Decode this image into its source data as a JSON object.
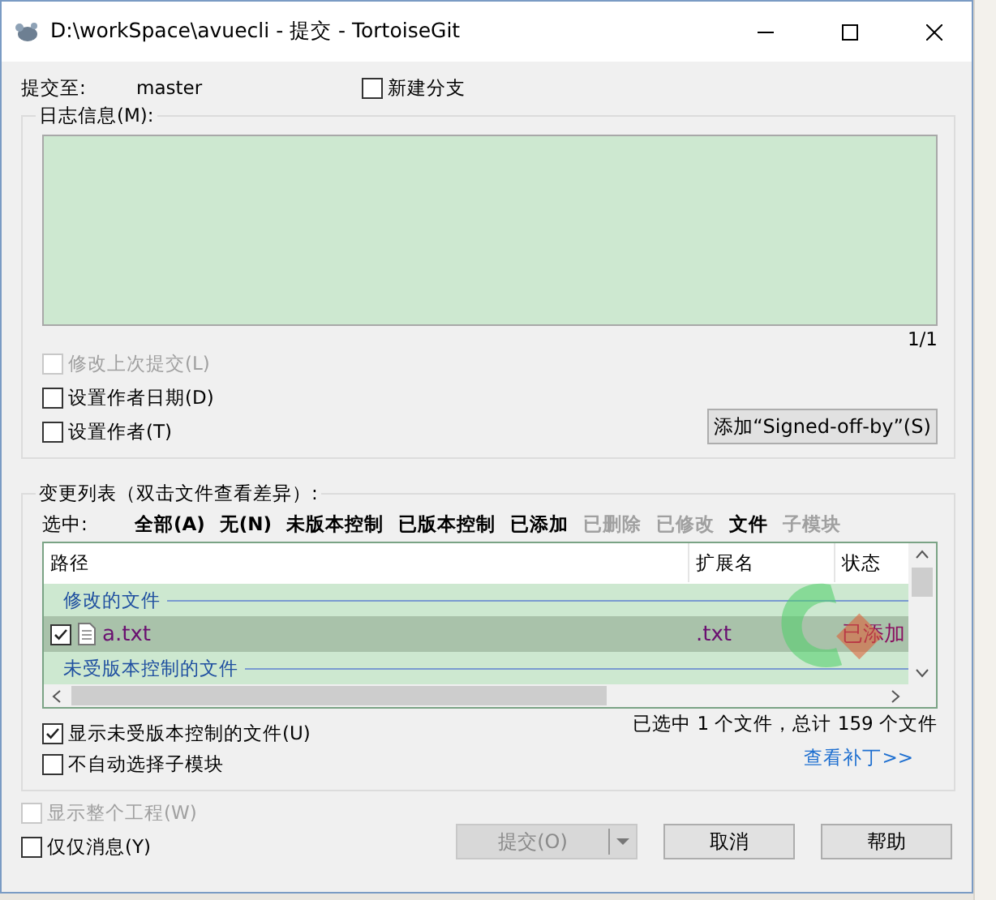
{
  "window": {
    "title": "D:\\workSpace\\avuecli - 提交 - TortoiseGit"
  },
  "commit_to": {
    "label": "提交至:",
    "value": "master"
  },
  "new_branch": {
    "label": "新建分支",
    "checked": false
  },
  "log": {
    "label": "日志信息(M):",
    "counter": "1/1"
  },
  "log_options": [
    {
      "label": "修改上次提交(L)",
      "checked": false,
      "disabled": true
    },
    {
      "label": "设置作者日期(D)",
      "checked": false,
      "disabled": false
    },
    {
      "label": "设置作者(T)",
      "checked": false,
      "disabled": false
    }
  ],
  "signoff_button": "添加“Signed-off-by”(S)",
  "changes": {
    "label": "变更列表（双击文件查看差异）:",
    "select_label": "选中:",
    "filters": [
      {
        "label": "全部(A)",
        "disabled": false
      },
      {
        "label": "无(N)",
        "disabled": false
      },
      {
        "label": "未版本控制",
        "disabled": false
      },
      {
        "label": "已版本控制",
        "disabled": false
      },
      {
        "label": "已添加",
        "disabled": false
      },
      {
        "label": "已删除",
        "disabled": true
      },
      {
        "label": "已修改",
        "disabled": true
      },
      {
        "label": "文件",
        "disabled": false
      },
      {
        "label": "子模块",
        "disabled": true
      }
    ]
  },
  "table": {
    "columns": [
      "路径",
      "扩展名",
      "状态"
    ],
    "rows": [
      {
        "kind": "group",
        "label": "修改的文件"
      },
      {
        "kind": "file",
        "path": "a.txt",
        "ext": ".txt",
        "status": "已添加",
        "checked": true,
        "selected": true
      },
      {
        "kind": "group",
        "label": "未受版本控制的文件"
      }
    ]
  },
  "list_options": [
    {
      "label": "显示未受版本控制的文件(U)",
      "checked": true,
      "disabled": false
    },
    {
      "label": "不自动选择子模块",
      "checked": false,
      "disabled": false
    }
  ],
  "summary": "已选中 1 个文件，总计 159 个文件",
  "patch_link": "查看补丁>>",
  "bottom_options": [
    {
      "label": "显示整个工程(W)",
      "checked": false,
      "disabled": true
    },
    {
      "label": "仅仅消息(Y)",
      "checked": false,
      "disabled": false
    }
  ],
  "buttons": [
    {
      "kind": "split",
      "label": "提交(O)",
      "disabled": true
    },
    {
      "kind": "plain",
      "label": "取消",
      "disabled": false
    },
    {
      "kind": "plain",
      "label": "帮助",
      "disabled": false
    }
  ]
}
